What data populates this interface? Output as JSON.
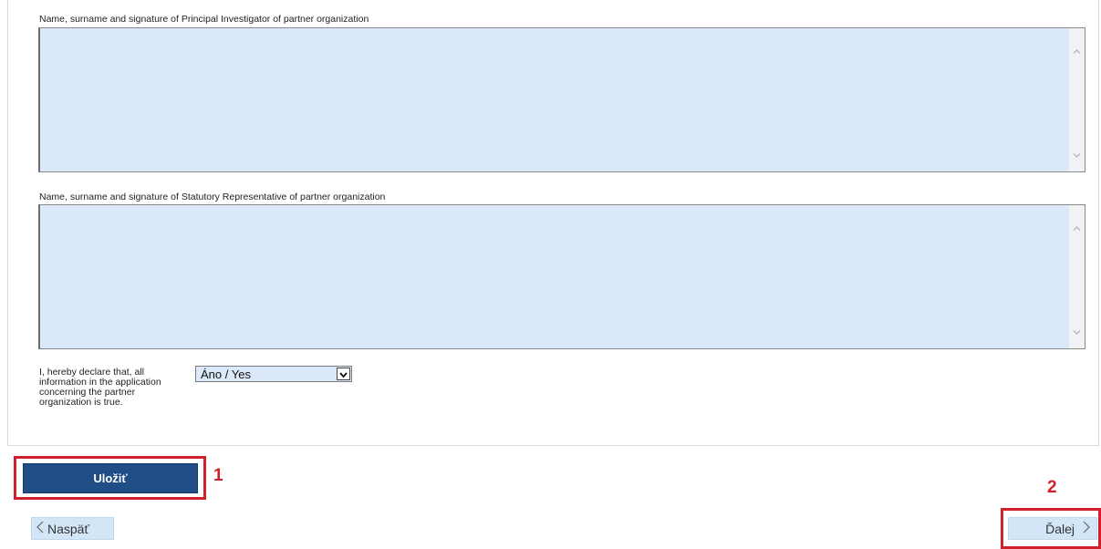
{
  "form": {
    "pi_signature_label": "Name, surname and signature of Principal Investigator of partner organization",
    "pi_signature_value": "",
    "statutory_signature_label": "Name, surname and signature of Statutory Representative of partner organization",
    "statutory_signature_value": "",
    "declaration_label": "I, hereby declare that, all information in the application concerning the partner organization is true.",
    "declaration_select_value": "Áno / Yes"
  },
  "actions": {
    "save_label": "Uložiť",
    "back_label": "Naspäť",
    "next_label": "Ďalej"
  },
  "annotations": {
    "marker_1": "1",
    "marker_2": "2",
    "color": "#d0202a"
  },
  "colors": {
    "field_bg": "#dbe9fb",
    "button_primary": "#1f4e86",
    "nav_button_bg": "#d3e6f7"
  },
  "icons": [
    "scroll-up-icon",
    "scroll-down-icon",
    "dropdown-arrow-icon",
    "chevron-left-icon",
    "chevron-right-icon"
  ]
}
